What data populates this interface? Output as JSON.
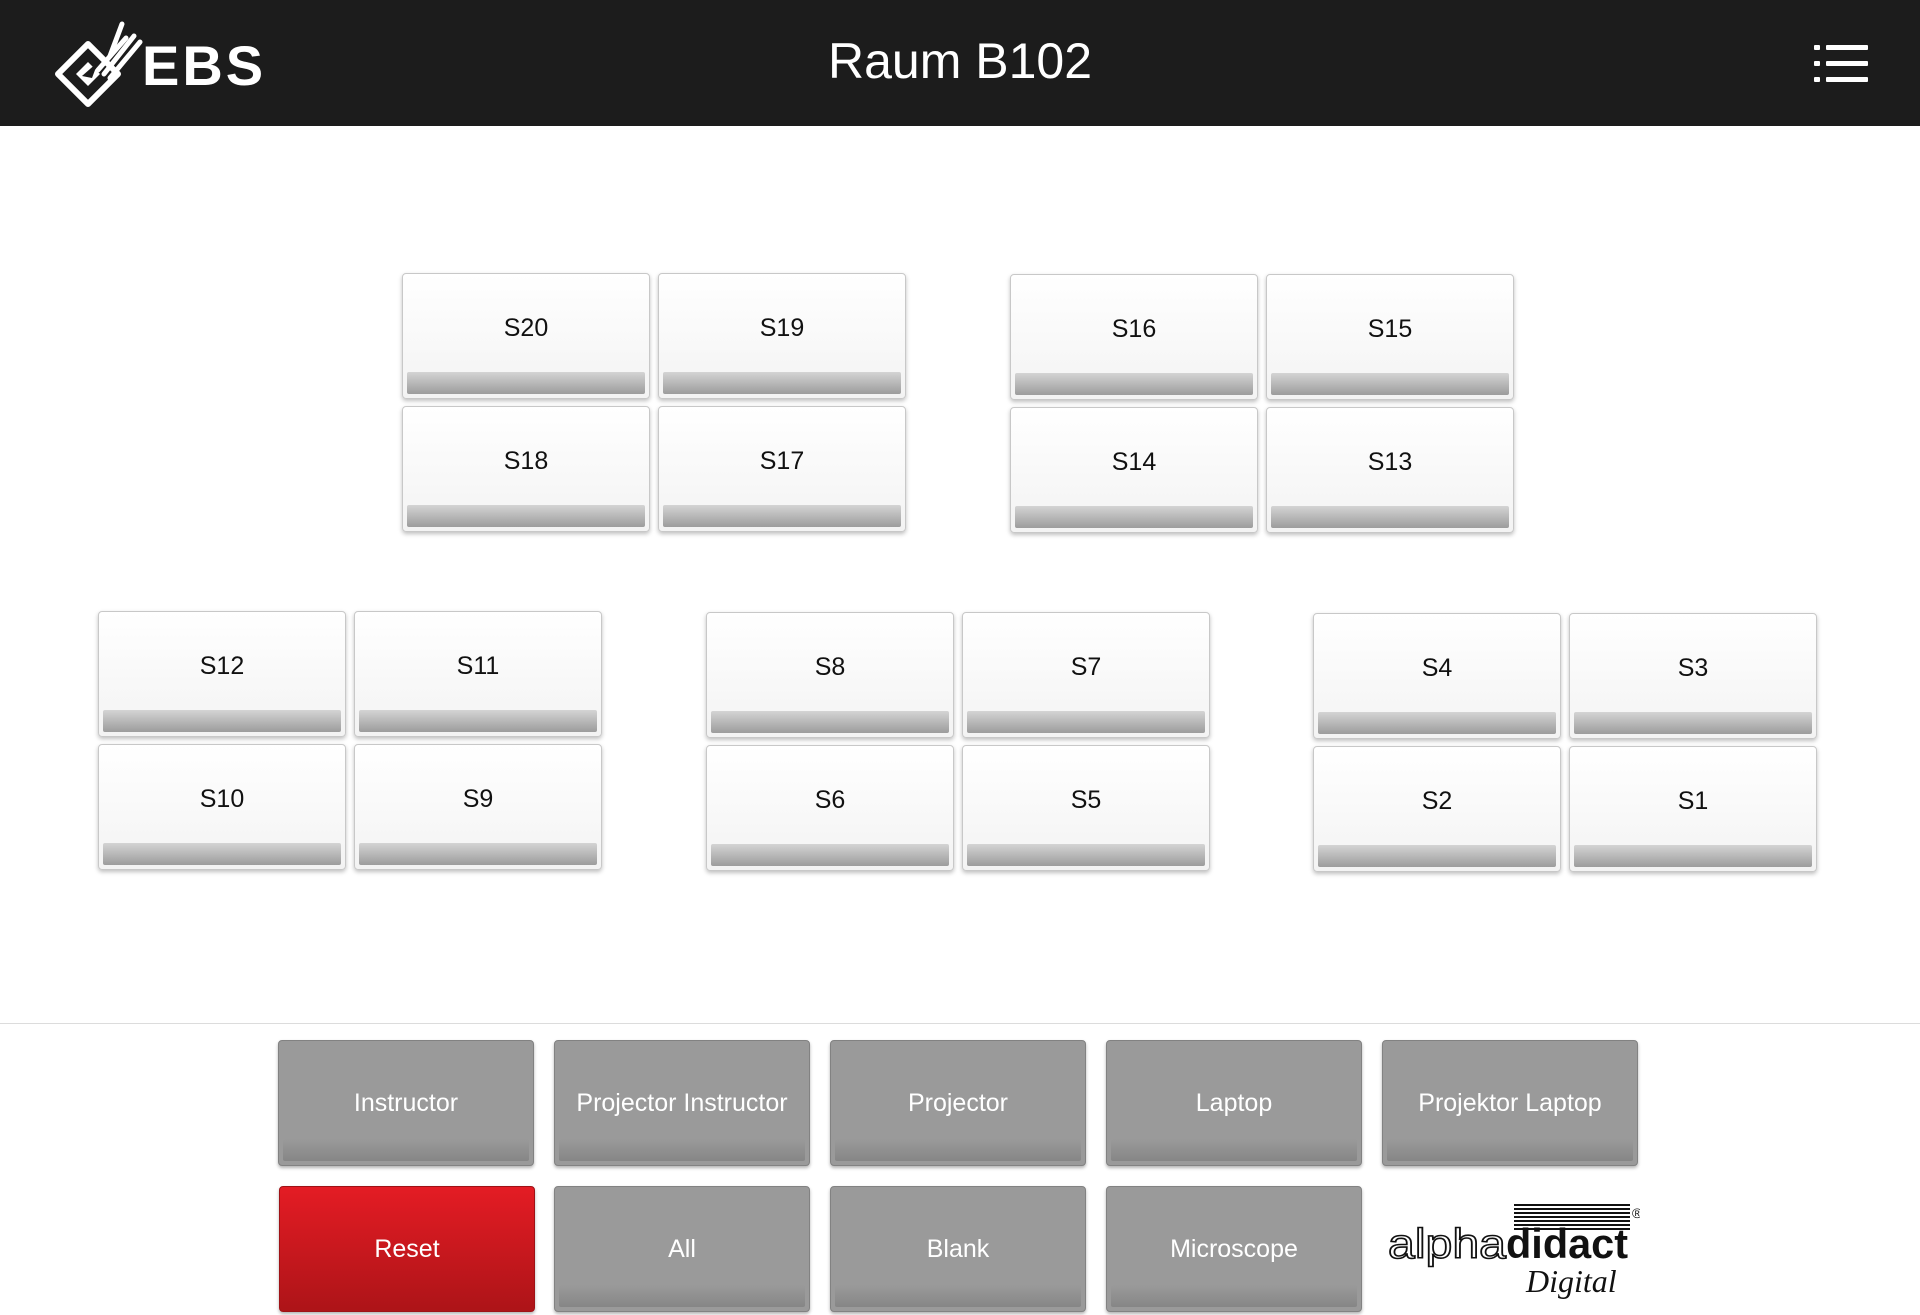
{
  "header": {
    "logo_text": "EBS",
    "title": "Raum B102",
    "menu_icon": "list-icon"
  },
  "seats": {
    "group_a": [
      {
        "id": "S20",
        "label": "S20"
      },
      {
        "id": "S19",
        "label": "S19"
      },
      {
        "id": "S18",
        "label": "S18"
      },
      {
        "id": "S17",
        "label": "S17"
      }
    ],
    "group_b": [
      {
        "id": "S16",
        "label": "S16"
      },
      {
        "id": "S15",
        "label": "S15"
      },
      {
        "id": "S14",
        "label": "S14"
      },
      {
        "id": "S13",
        "label": "S13"
      }
    ],
    "group_c": [
      {
        "id": "S12",
        "label": "S12"
      },
      {
        "id": "S11",
        "label": "S11"
      },
      {
        "id": "S10",
        "label": "S10"
      },
      {
        "id": "S9",
        "label": "S9"
      }
    ],
    "group_d": [
      {
        "id": "S8",
        "label": "S8"
      },
      {
        "id": "S7",
        "label": "S7"
      },
      {
        "id": "S6",
        "label": "S6"
      },
      {
        "id": "S5",
        "label": "S5"
      }
    ],
    "group_e": [
      {
        "id": "S4",
        "label": "S4"
      },
      {
        "id": "S3",
        "label": "S3"
      },
      {
        "id": "S2",
        "label": "S2"
      },
      {
        "id": "S1",
        "label": "S1"
      }
    ]
  },
  "sources": {
    "instructor": "Instructor",
    "projector_instructor": "Projector Instructor",
    "projector": "Projector",
    "laptop": "Laptop",
    "projektor_laptop": "Projektor Laptop",
    "reset": "Reset",
    "all": "All",
    "blank": "Blank",
    "microscope": "Microscope"
  },
  "brand": {
    "name_light": "alpha",
    "name_bold": "didact",
    "tagline": "Digital",
    "registered": "®"
  },
  "colors": {
    "header_bg": "#1c1c1c",
    "seat_bg": "#ffffff",
    "source_bg": "#9a9a9a",
    "reset_red": "#e41c24"
  }
}
